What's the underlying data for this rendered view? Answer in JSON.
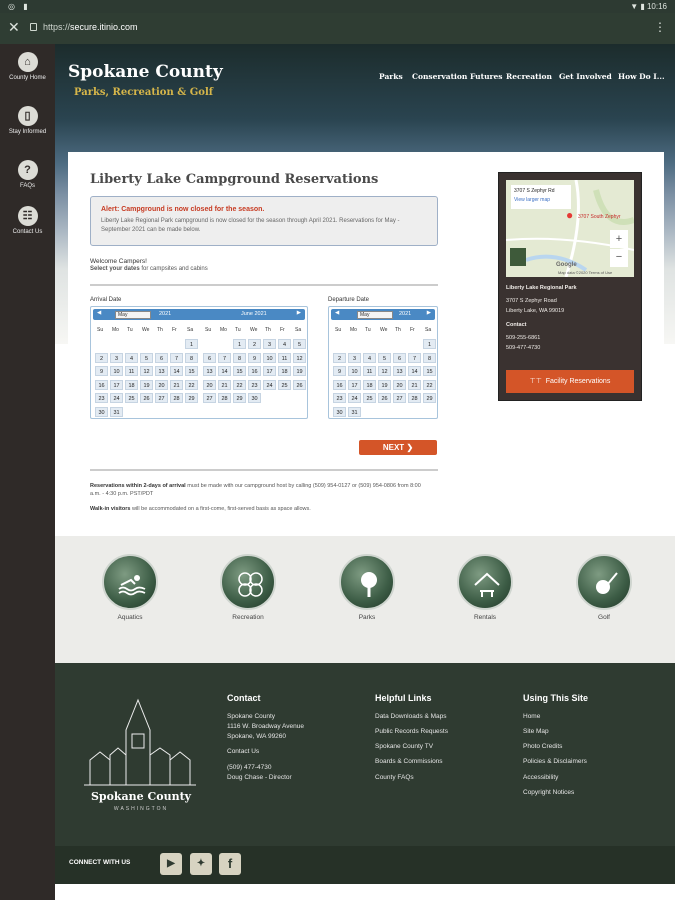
{
  "status": {
    "time": "10:16"
  },
  "browser": {
    "url_prefix": "https://",
    "url_host": "secure.itinio.com"
  },
  "sidebar": {
    "items": [
      {
        "label": "County Home",
        "icon": "home-icon"
      },
      {
        "label": "Stay Informed",
        "icon": "phone-icon"
      },
      {
        "label": "FAQs",
        "icon": "question-icon"
      },
      {
        "label": "Contact Us",
        "icon": "contact-icon"
      }
    ]
  },
  "header": {
    "brand": "Spokane County",
    "tagline": "Parks, Recreation & Golf",
    "nav": [
      "Parks",
      "Conservation Futures",
      "Recreation",
      "Get Involved",
      "How Do I..."
    ]
  },
  "main": {
    "title": "Liberty Lake Campground Reservations",
    "alert_heading": "Alert: Campground is now closed for the season.",
    "alert_text": "Liberty Lake Regional Park campground is now closed for the season through April 2021. Reservations for May - September 2021 can be made below.",
    "welcome": "Welcome Campers!",
    "select_bold": "Select your dates",
    "select_rest": " for campsites and cabins",
    "arrival_label": "Arrival Date",
    "departure_label": "Departure Date",
    "next_label": "NEXT",
    "note1_bold": "Reservations within 2-days of arrival",
    "note1_rest": " must be made with our campground host by calling (509) 954-0127 or (509) 954-0806 from 8:00 a.m. - 4:30 p.m. PST/PDT",
    "note2_bold": "Walk-in visitors",
    "note2_rest": " will be accommodated on a first-come, first-served basis as space allows."
  },
  "calendars": {
    "dow": [
      "Su",
      "Mo",
      "Tu",
      "We",
      "Th",
      "Fr",
      "Sa"
    ],
    "arrival_may": {
      "month": "May",
      "year": "2021"
    },
    "arrival_june": {
      "title": "June 2021"
    },
    "departure_may": {
      "month": "May",
      "year": "2021"
    }
  },
  "map": {
    "address_title": "3707 S Zephyr Rd",
    "view_larger": "View larger map",
    "pin_label": "3707 South Zephyr",
    "park_name": "Liberty Lake Regional Park",
    "street": "3707 S Zephyr Road",
    "city": "Liberty Lake, WA 99019",
    "contact_label": "Contact",
    "phone1": "509-255-6861",
    "phone2": "509-477-4730",
    "attribution": "Map data ©2020   Terms of Use",
    "google": "Google",
    "zoom_in": "+",
    "zoom_out": "−"
  },
  "facility_button": "Facility Reservations",
  "categories": [
    "Aquatics",
    "Recreation",
    "Parks",
    "Rentals",
    "Golf"
  ],
  "footer": {
    "logo_title": "Spokane County",
    "logo_sub": "WASHINGTON",
    "contact_heading": "Contact",
    "contact_lines": [
      "Spokane County",
      "1116 W. Broadway Avenue",
      "Spokane, WA 99260"
    ],
    "contact_us": "Contact Us",
    "phone": "(509) 477-4730",
    "director": "Doug Chase - Director",
    "helpful_heading": "Helpful Links",
    "helpful_links": [
      "Data Downloads & Maps",
      "Public Records Requests",
      "Spokane County TV",
      "Boards & Commissions",
      "County FAQs"
    ],
    "using_heading": "Using This Site",
    "using_links": [
      "Home",
      "Site Map",
      "Photo Credits",
      "Policies & Disclaimers",
      "Accessibility",
      "Copyright Notices"
    ],
    "connect": "CONNECT WITH US",
    "social": [
      "youtube-icon",
      "twitter-icon",
      "facebook-icon"
    ]
  },
  "colors": {
    "accent": "#d45528",
    "footer": "#2f3b31",
    "calendar_header": "#4a89c4",
    "sidebar": "#2f2a28"
  }
}
